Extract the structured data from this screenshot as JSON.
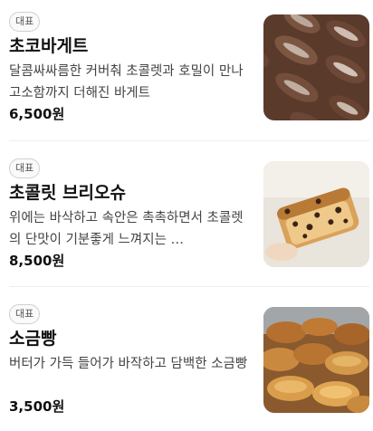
{
  "menu": {
    "items": [
      {
        "badge": "대표",
        "name": "초코바게트",
        "description": "달콤싸싸름한 커버춰 초콜렛과 호밀이 만나 고소함까지 더해진 바게트",
        "price": "6,500원",
        "image_icon": "chocolate-baguette-photo"
      },
      {
        "badge": "대표",
        "name": "초콜릿 브리오슈",
        "description": "위에는 바삭하고 속안은 촉촉하면서 초콜렛의 단맛이 기분좋게 느껴지는 …",
        "price": "8,500원",
        "image_icon": "chocolate-brioche-photo"
      },
      {
        "badge": "대표",
        "name": "소금빵",
        "description": "버터가 가득 들어가 바작하고 담백한 소금빵",
        "price": "3,500원",
        "image_icon": "salt-bread-photo"
      }
    ]
  }
}
